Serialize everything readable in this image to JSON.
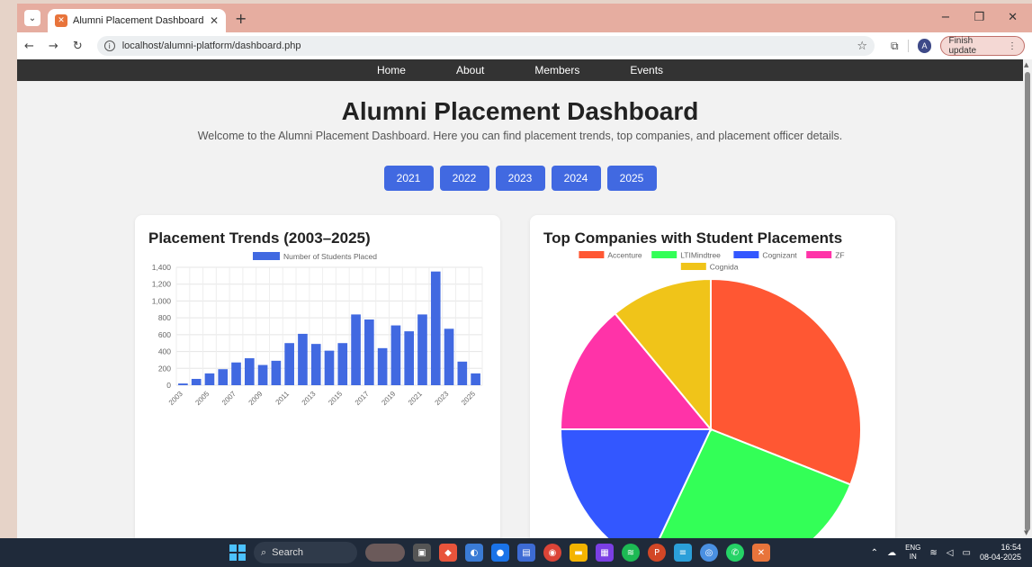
{
  "browser": {
    "tab_title": "Alumni Placement Dashboard",
    "url": "localhost/alumni-platform/dashboard.php",
    "profile_initial": "A",
    "finish_update_label": "Finish update"
  },
  "nav": {
    "items": [
      "Home",
      "About",
      "Members",
      "Events"
    ]
  },
  "page": {
    "title": "Alumni Placement Dashboard",
    "subtitle": "Welcome to the Alumni Placement Dashboard. Here you can find placement trends, top companies, and placement officer details."
  },
  "years": [
    "2021",
    "2022",
    "2023",
    "2024",
    "2025"
  ],
  "trends_card": {
    "title": "Placement Trends (2003–2025)"
  },
  "companies_card": {
    "title": "Top Companies with Student Placements"
  },
  "chart_data": [
    {
      "type": "bar",
      "title": "Placement Trends (2003–2025)",
      "legend": "Number of Students Placed",
      "color": "#4169e1",
      "categories": [
        "2003",
        "2004",
        "2005",
        "2006",
        "2007",
        "2008",
        "2009",
        "2010",
        "2011",
        "2012",
        "2013",
        "2014",
        "2015",
        "2016",
        "2017",
        "2018",
        "2019",
        "2020",
        "2021",
        "2022",
        "2023",
        "2024",
        "2025"
      ],
      "tick_labels": [
        "2003",
        "2005",
        "2007",
        "2009",
        "2011",
        "2013",
        "2015",
        "2017",
        "2019",
        "2021",
        "2023",
        "2025"
      ],
      "values": [
        20,
        75,
        140,
        190,
        270,
        320,
        240,
        290,
        500,
        610,
        490,
        410,
        500,
        840,
        780,
        440,
        710,
        640,
        840,
        1350,
        670,
        280,
        140
      ],
      "ylim": [
        0,
        1400
      ],
      "yticks": [
        0,
        200,
        400,
        600,
        800,
        1000,
        1200,
        1400
      ],
      "ytick_labels": [
        "0",
        "200",
        "400",
        "600",
        "800",
        "1,000",
        "1,200",
        "1,400"
      ]
    },
    {
      "type": "pie",
      "title": "Top Companies with Student Placements",
      "labels": [
        "Accenture",
        "LTIMindtree",
        "Cognizant",
        "ZF",
        "Cognida"
      ],
      "values": [
        31,
        26,
        18,
        14,
        11
      ],
      "colors": [
        "#ff5733",
        "#33ff57",
        "#3357ff",
        "#ff33a8",
        "#f0c419"
      ]
    }
  ],
  "taskbar": {
    "search_label": "Search",
    "lang_top": "ENG",
    "lang_bottom": "IN",
    "time": "16:54",
    "date": "08-04-2025"
  }
}
